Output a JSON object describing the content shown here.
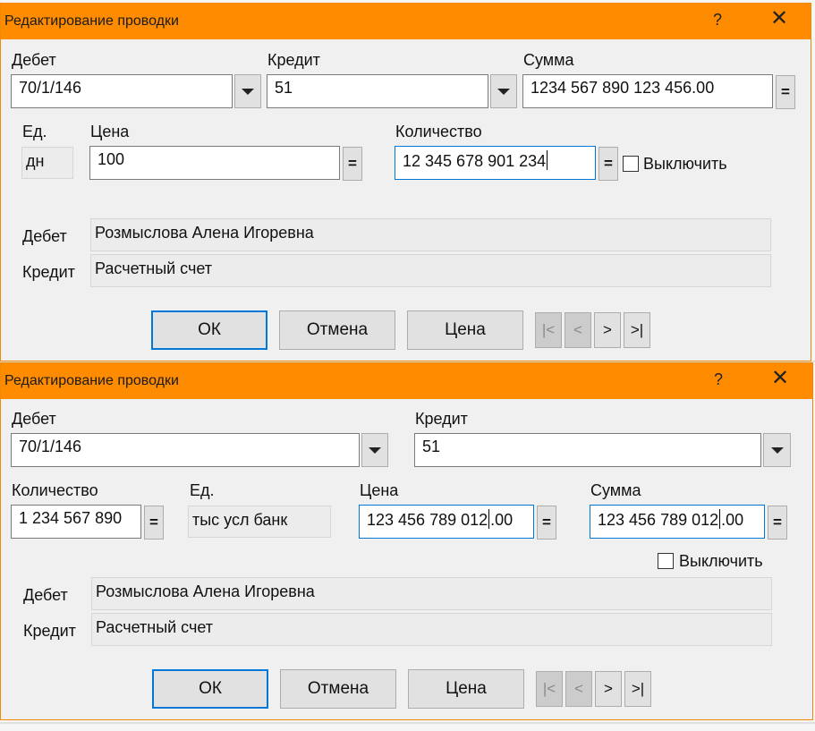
{
  "dialog1": {
    "title": "Редактирование проводки",
    "help": "?",
    "close": "✕",
    "debet_label": "Дебет",
    "debet_value": "70/1/146",
    "kredit_label": "Кредит",
    "kredit_value": "51",
    "summa_label": "Сумма",
    "summa_value": "1234 567 890 123 456.00",
    "ed_label": "Ед.",
    "ed_value": "дн",
    "cena_label": "Цена",
    "cena_value": "100",
    "kolichestvo_label": "Количество",
    "kolichestvo_value": "12 345 678 901 234",
    "eq": "=",
    "exclude_label": "Выключить",
    "info_debet_label": "Дебет",
    "info_debet_value": "Розмыслова Алена Игоревна",
    "info_kredit_label": "Кредит",
    "info_kredit_value": "Расчетный счет",
    "ok": "ОК",
    "cancel": "Отмена",
    "price": "Цена",
    "nav_first": "|<",
    "nav_prev": "<",
    "nav_next": ">",
    "nav_last": ">|"
  },
  "dialog2": {
    "title": "Редактирование проводки",
    "help": "?",
    "close": "✕",
    "debet_label": "Дебет",
    "debet_value": "70/1/146",
    "kredit_label": "Кредит",
    "kredit_value": "51",
    "kolichestvo_label": "Количество",
    "kolichestvo_value": "1 234 567 890",
    "ed_label": "Ед.",
    "ed_value": "тыс усл банк",
    "cena_label": "Цена",
    "cena_value_a": "123 456 789 012",
    "cena_value_b": ".00",
    "summa_label": "Сумма",
    "summa_value_a": "123 456 789 012",
    "summa_value_b": ".00",
    "eq": "=",
    "exclude_label": "Выключить",
    "info_debet_label": "Дебет",
    "info_debet_value": "Розмыслова Алена Игоревна",
    "info_kredit_label": "Кредит",
    "info_kredit_value": "Расчетный счет",
    "ok": "ОК",
    "cancel": "Отмена",
    "price": "Цена",
    "nav_first": "|<",
    "nav_prev": "<",
    "nav_next": ">",
    "nav_last": ">|"
  }
}
